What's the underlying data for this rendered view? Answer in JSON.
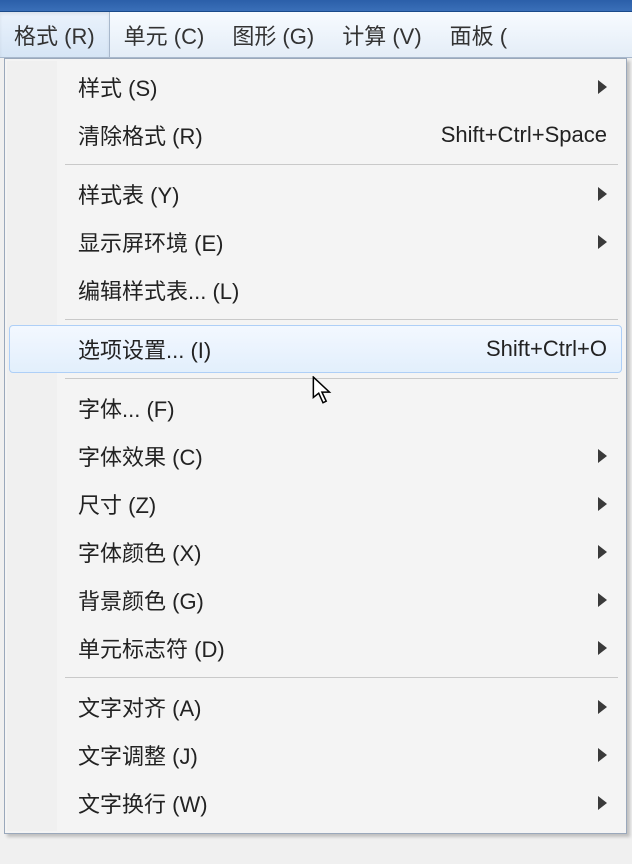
{
  "menubar": {
    "items": [
      {
        "label": "格式 (R)",
        "active": true
      },
      {
        "label": "单元 (C)"
      },
      {
        "label": "图形 (G)"
      },
      {
        "label": "计算 (V)"
      },
      {
        "label": "面板 ("
      }
    ]
  },
  "dropdown": {
    "groups": [
      [
        {
          "label": "样式 (S)",
          "submenu": true
        },
        {
          "label": "清除格式 (R)",
          "shortcut": "Shift+Ctrl+Space"
        }
      ],
      [
        {
          "label": "样式表 (Y)",
          "submenu": true
        },
        {
          "label": "显示屏环境 (E)",
          "submenu": true
        },
        {
          "label": "编辑样式表... (L)"
        }
      ],
      [
        {
          "label": "选项设置... (I)",
          "shortcut": "Shift+Ctrl+O",
          "hover": true
        }
      ],
      [
        {
          "label": "字体... (F)"
        },
        {
          "label": "字体效果 (C)",
          "submenu": true
        },
        {
          "label": "尺寸 (Z)",
          "submenu": true
        },
        {
          "label": "字体颜色 (X)",
          "submenu": true
        },
        {
          "label": "背景颜色 (G)",
          "submenu": true
        },
        {
          "label": "单元标志符 (D)",
          "submenu": true
        }
      ],
      [
        {
          "label": "文字对齐 (A)",
          "submenu": true
        },
        {
          "label": "文字调整 (J)",
          "submenu": true
        },
        {
          "label": "文字换行 (W)",
          "submenu": true
        }
      ]
    ]
  }
}
